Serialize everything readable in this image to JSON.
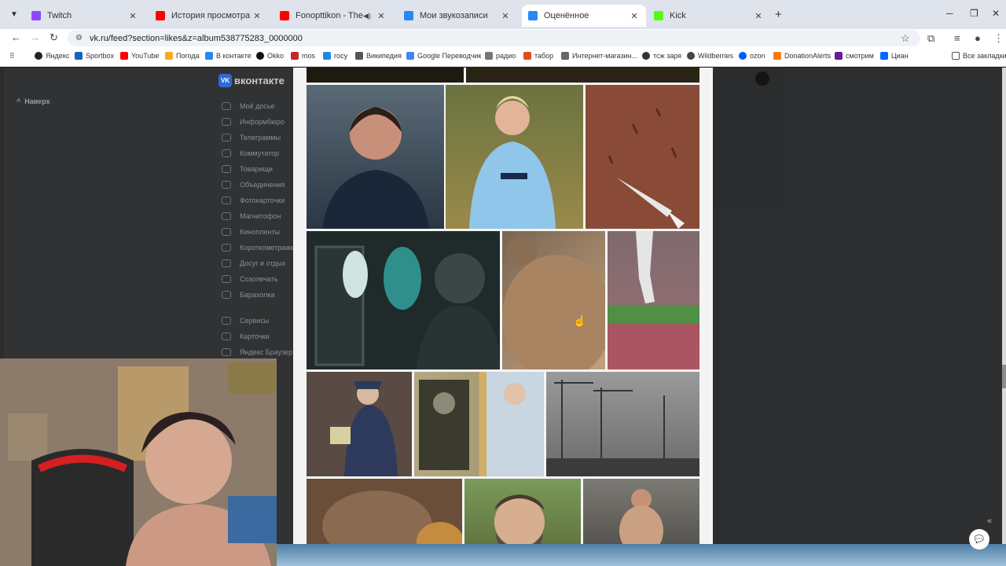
{
  "browser": {
    "tabs": [
      {
        "title": "Twitch",
        "favicon_color": "#9146ff",
        "active": false
      },
      {
        "title": "История просмотра - YouTube",
        "favicon_color": "#ff0000",
        "active": false
      },
      {
        "title": "Fonopttikon - They Live - Yo",
        "favicon_color": "#ff0000",
        "active": false,
        "audio": true
      },
      {
        "title": "Мои звукозаписи",
        "favicon_color": "#2787f5",
        "active": false
      },
      {
        "title": "Оценённое",
        "favicon_color": "#2787f5",
        "active": true
      },
      {
        "title": "Kick",
        "favicon_color": "#53fc18",
        "active": false
      }
    ],
    "url": "vk.ru/feed?section=likes&z=album538775283_0000000",
    "bookmarks": [
      {
        "label": "Яндекс",
        "color": "#222222"
      },
      {
        "label": "Sportbox",
        "color": "#1565c0"
      },
      {
        "label": "YouTube",
        "color": "#ff0000"
      },
      {
        "label": "Погода",
        "color": "#f9a825"
      },
      {
        "label": "В контакте",
        "color": "#2787f5"
      },
      {
        "label": "Okko",
        "color": "#111111"
      },
      {
        "label": "mos",
        "color": "#c62828"
      },
      {
        "label": "госу",
        "color": "#1e88e5"
      },
      {
        "label": "Википедия",
        "color": "#555555"
      },
      {
        "label": "Google Переводчик",
        "color": "#4285f4"
      },
      {
        "label": "радио",
        "color": "#777777"
      },
      {
        "label": "табор",
        "color": "#e64a19"
      },
      {
        "label": "Интернет-магазин...",
        "color": "#666666"
      },
      {
        "label": "тсж заря",
        "color": "#333333"
      },
      {
        "label": "Wildberries",
        "color": "#444444"
      },
      {
        "label": "ozon",
        "color": "#005bff"
      },
      {
        "label": "DonationAlerts",
        "color": "#f57c00"
      },
      {
        "label": "смотрим",
        "color": "#6a1b9a"
      },
      {
        "label": "Циан",
        "color": "#0468ff"
      }
    ],
    "all_bookmarks": "Все закладки"
  },
  "sidebar": {
    "up_label": "Наверх",
    "logo_text": "вконтакте",
    "items": [
      {
        "label": "Моё досье"
      },
      {
        "label": "Информбюро"
      },
      {
        "label": "Телеграммы"
      },
      {
        "label": "Коммутатор"
      },
      {
        "label": "Товарищи"
      },
      {
        "label": "Объединения"
      },
      {
        "label": "Фотокарточки"
      },
      {
        "label": "Магнитофон"
      },
      {
        "label": "Кинопленты"
      },
      {
        "label": "Короткометражки"
      },
      {
        "label": "Досуг и отдых"
      },
      {
        "label": "Созолечать"
      },
      {
        "label": "Барахолка"
      },
      {
        "label": "Сервисы"
      },
      {
        "label": "Карточки"
      },
      {
        "label": "Яндекс Браузер"
      }
    ]
  },
  "feed": {
    "photos": [
      {
        "name": "coach-portrait",
        "color": "#3b4a5a"
      },
      {
        "name": "footballer-city-kit",
        "color": "#8fbfe0"
      },
      {
        "name": "knife-on-wall",
        "color": "#8a4a38"
      },
      {
        "name": "spacesuit-subway",
        "color": "#2d3a3a"
      },
      {
        "name": "cat-fur",
        "color": "#9c7b5f"
      },
      {
        "name": "player-rain",
        "color": "#8e6b70"
      },
      {
        "name": "police-officer",
        "color": "#36405a"
      },
      {
        "name": "old-portraits",
        "color": "#b2a27a"
      },
      {
        "name": "construction-bw",
        "color": "#8a8a8a"
      },
      {
        "name": "bread-closeup",
        "color": "#7a5a44"
      },
      {
        "name": "man-selfie",
        "color": "#6e8a50"
      },
      {
        "name": "man-shirtless",
        "color": "#8c7a66"
      }
    ]
  }
}
